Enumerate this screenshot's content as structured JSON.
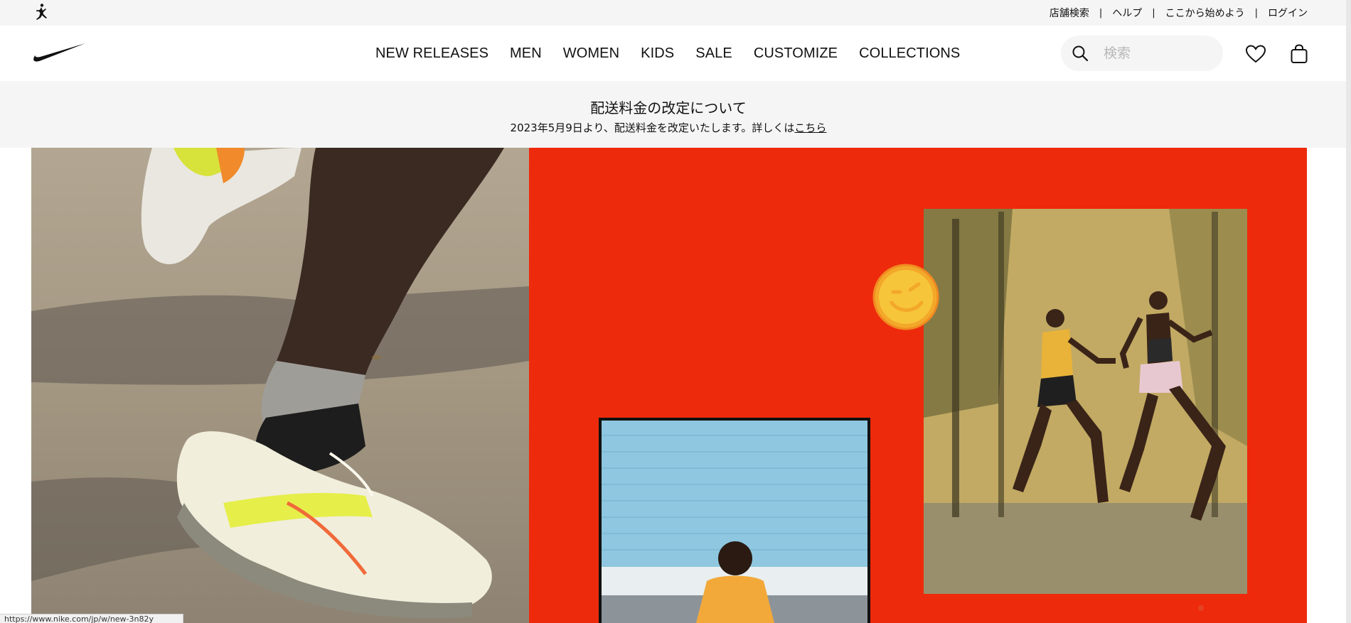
{
  "utility_bar": {
    "brand_icon": "jordan-jumpman-icon",
    "links": [
      "店舗検索",
      "ヘルプ",
      "ここから始めよう",
      "ログイン"
    ],
    "separator": "|"
  },
  "nav": {
    "brand_icon": "nike-swoosh-icon",
    "items": [
      "NEW RELEASES",
      "MEN",
      "WOMEN",
      "KIDS",
      "SALE",
      "CUSTOMIZE",
      "COLLECTIONS"
    ],
    "search_placeholder": "検索",
    "search_icon": "search-icon",
    "favorites_icon": "heart-icon",
    "bag_icon": "shopping-bag-icon"
  },
  "announcement": {
    "title": "配送料金の改定について",
    "body": "2023年5月9日より、配送料金を改定いたします。詳しくは",
    "link": "こちら"
  },
  "hero": {
    "left_image": "runner-shoe-photo",
    "right_background": "#ee2a0c",
    "sticker_icon": "winking-smiley-icon",
    "photo_1": "two-runners-photo",
    "photo_2": "seated-runner-photo"
  },
  "status_bar": {
    "url": "https://www.nike.com/jp/w/new-3n82y"
  }
}
